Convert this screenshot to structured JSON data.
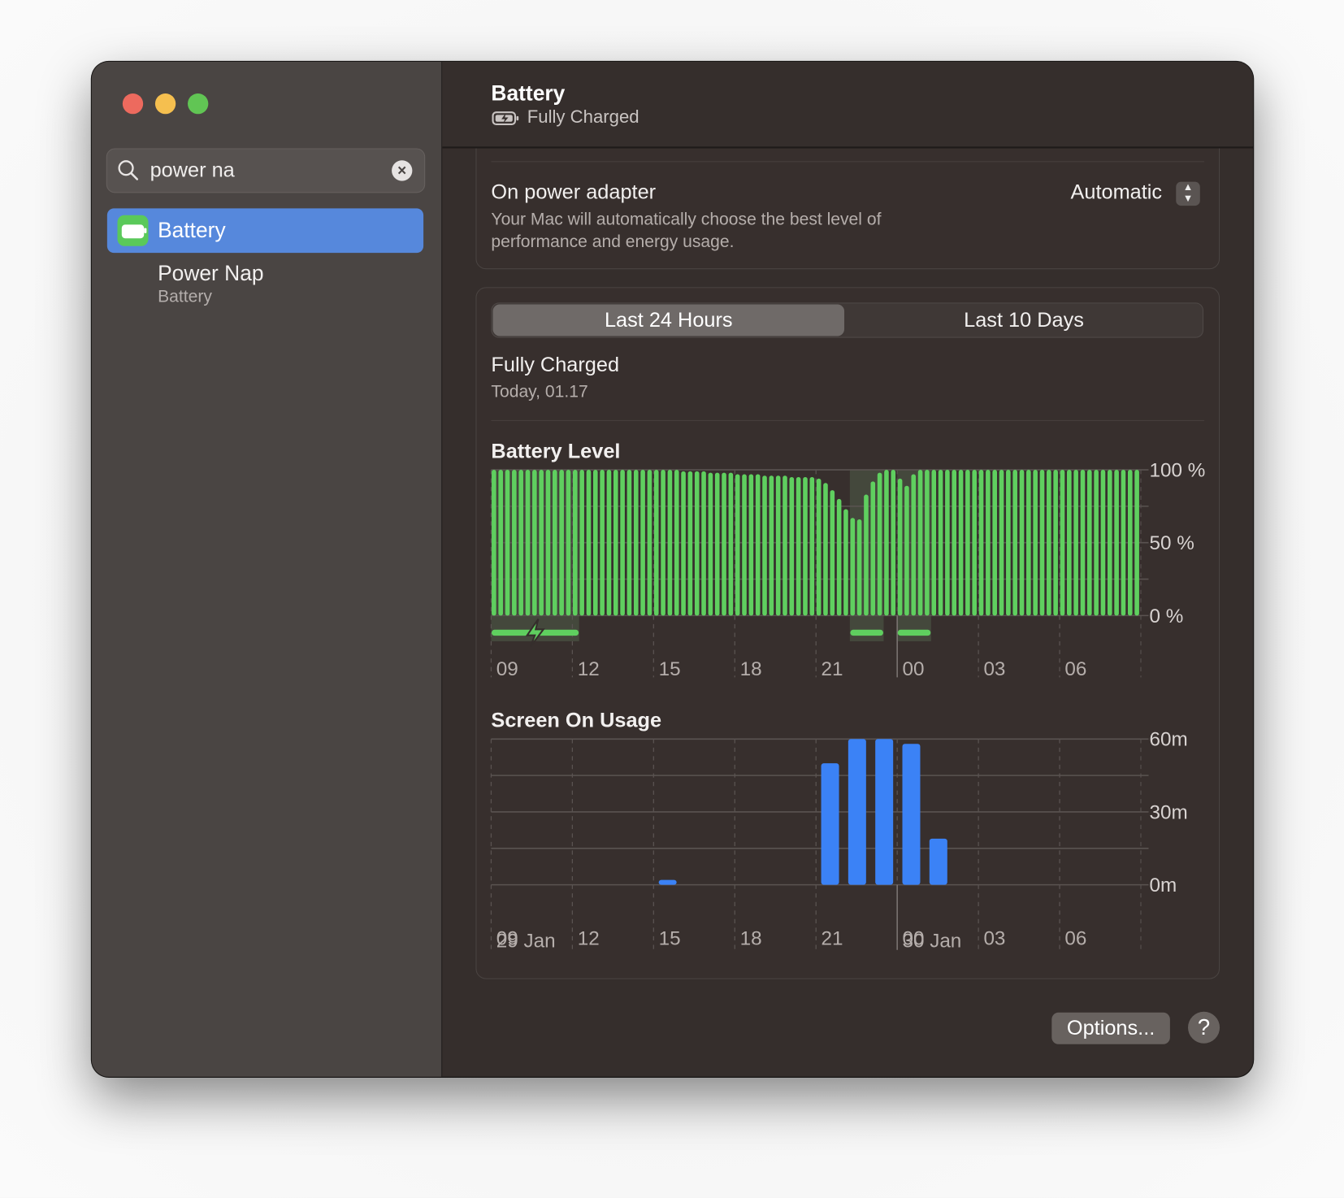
{
  "window": {
    "traffic_lights": {
      "close": "#ed6a5e",
      "minimize": "#f5bf4f",
      "zoom": "#61c554"
    }
  },
  "sidebar": {
    "search": {
      "value": "power na",
      "icon": "search-icon",
      "clear_icon": "clear-icon"
    },
    "items": [
      {
        "label": "Battery",
        "icon": "battery-icon",
        "selected": true,
        "accent": "#5688dc"
      },
      {
        "label": "Power Nap",
        "subtitle": "Battery"
      }
    ]
  },
  "header": {
    "title": "Battery",
    "status": "Fully Charged",
    "status_icon": "battery-charging-icon"
  },
  "power_adapter": {
    "title": "On power adapter",
    "description_line1": "Your Mac will automatically choose the best level of",
    "description_line2": "performance and energy usage.",
    "select_value": "Automatic"
  },
  "usage": {
    "tabs": [
      {
        "label": "Last 24 Hours",
        "selected": true
      },
      {
        "label": "Last 10 Days",
        "selected": false
      }
    ],
    "status_title": "Fully Charged",
    "status_time": "Today, 01.17"
  },
  "chart_data": [
    {
      "type": "bar",
      "title": "Battery Level",
      "x_ticks": [
        "09",
        "12",
        "15",
        "18",
        "21",
        "00",
        "03",
        "06"
      ],
      "y_ticks": [
        "100 %",
        "50 %",
        "0 %"
      ],
      "ylim": [
        0,
        100
      ],
      "color": "#5fcf5f",
      "values": [
        100,
        100,
        100,
        100,
        100,
        100,
        100,
        100,
        100,
        100,
        100,
        100,
        100,
        100,
        100,
        100,
        100,
        100,
        100,
        100,
        100,
        100,
        100,
        100,
        100,
        100,
        100,
        100,
        99,
        99,
        99,
        99,
        98,
        98,
        98,
        98,
        97,
        97,
        97,
        97,
        96,
        96,
        96,
        96,
        95,
        95,
        95,
        95,
        94,
        91,
        86,
        80,
        73,
        67,
        66,
        83,
        92,
        98,
        100,
        100,
        94,
        89,
        97,
        100,
        100,
        100,
        100,
        100,
        100,
        100,
        100,
        100,
        100,
        100,
        100,
        100,
        100,
        100,
        100,
        100,
        100,
        100,
        100,
        100,
        100,
        100,
        100,
        100,
        100,
        100,
        100,
        100,
        100,
        100,
        100,
        100
      ],
      "charging_periods": [
        [
          "09:00",
          "12:15"
        ],
        [
          "22:15",
          "23:30"
        ],
        [
          "00:00",
          "01:15"
        ]
      ],
      "grid": true
    },
    {
      "type": "bar",
      "title": "Screen On Usage",
      "x_ticks": [
        "09",
        "12",
        "15",
        "18",
        "21",
        "00",
        "03",
        "06"
      ],
      "date_labels": [
        "29 Jan",
        "30 Jan"
      ],
      "y_ticks": [
        "60m",
        "30m",
        "0m"
      ],
      "ylim": [
        0,
        60
      ],
      "color": "#3b82f6",
      "categories": [
        "15",
        "21",
        "22",
        "23",
        "00",
        "01"
      ],
      "values": [
        2,
        50,
        60,
        60,
        58,
        19
      ],
      "grid": true
    }
  ],
  "footer": {
    "options_label": "Options...",
    "help_label": "?"
  }
}
